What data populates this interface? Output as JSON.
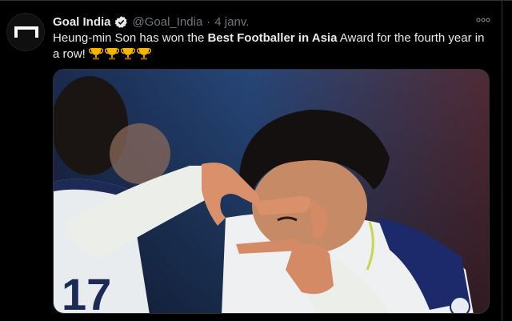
{
  "tweet": {
    "author_name": "Goal India",
    "handle": "@Goal_India",
    "separator": "·",
    "date": "4 janv.",
    "text_before": "Heung-min Son has won the ",
    "text_bold": "Best Footballer in Asia",
    "text_after": " Award for the fourth year in a row!",
    "trophy_count": 4
  },
  "icons": {
    "avatar": "goal-logo-icon",
    "verified": "verified-badge-icon",
    "more": "more-options-icon",
    "trophy": "trophy-icon"
  },
  "colors": {
    "background": "#000000",
    "text": "#e7e9ea",
    "muted": "#71767b",
    "verified": "#1d9bf0"
  }
}
